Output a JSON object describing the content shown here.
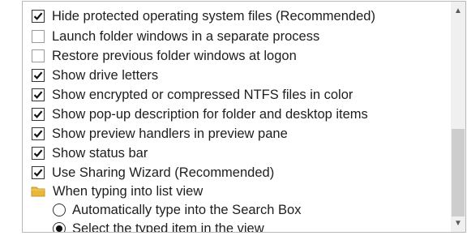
{
  "items": [
    {
      "type": "checkbox",
      "checked": true,
      "label": "Hide protected operating system files (Recommended)"
    },
    {
      "type": "checkbox",
      "checked": false,
      "label": "Launch folder windows in a separate process"
    },
    {
      "type": "checkbox",
      "checked": false,
      "label": "Restore previous folder windows at logon"
    },
    {
      "type": "checkbox",
      "checked": true,
      "label": "Show drive letters"
    },
    {
      "type": "checkbox",
      "checked": true,
      "label": "Show encrypted or compressed NTFS files in color"
    },
    {
      "type": "checkbox",
      "checked": true,
      "label": "Show pop-up description for folder and desktop items"
    },
    {
      "type": "checkbox",
      "checked": true,
      "label": "Show preview handlers in preview pane"
    },
    {
      "type": "checkbox",
      "checked": true,
      "label": "Show status bar"
    },
    {
      "type": "checkbox",
      "checked": true,
      "label": "Use Sharing Wizard (Recommended)"
    },
    {
      "type": "folder",
      "label": "When typing into list view"
    },
    {
      "type": "radio",
      "selected": false,
      "label": "Automatically type into the Search Box"
    },
    {
      "type": "radio",
      "selected": true,
      "label": "Select the typed item in the view"
    }
  ],
  "scrollbar": {
    "up_arrow": "▲",
    "down_arrow": "▼"
  },
  "colors": {
    "folder": "#e8b83a",
    "scrollbar_track": "#f0f0f0",
    "scrollbar_thumb": "#cdcdcd"
  }
}
